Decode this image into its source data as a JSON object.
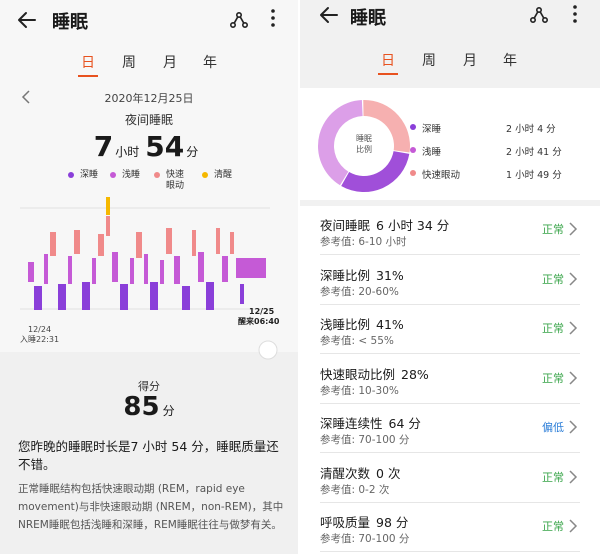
{
  "left": {
    "title": "睡眠",
    "tabs": [
      "日",
      "周",
      "月",
      "年"
    ],
    "active_tab": 0,
    "date": "2020年12月25日",
    "sleep_label": "夜间睡眠",
    "hours": "7",
    "hours_unit": "小时",
    "minutes": "54",
    "minutes_unit": "分",
    "legend": [
      {
        "label": "深睡",
        "color": "#8a3fd9"
      },
      {
        "label": "浅睡",
        "color": "#c55ad6"
      },
      {
        "label": "快速\n眼动",
        "color": "#f08a8a"
      },
      {
        "label": "清醒",
        "color": "#f5b800"
      }
    ],
    "start_date": "12/24",
    "start_time": "入睡22:31",
    "end_date": "12/25",
    "end_time": "醒来06:40",
    "score_label": "得分",
    "score": "85",
    "score_unit": "分",
    "summary": "您昨晚的睡眠时长是7 小时 54 分，睡眠质量还不错。",
    "description": "正常睡眠结构包括快速眼动期 (REM，rapid eye movement)与非快速眼动期 (NREM，non-REM)，其中NREM睡眠包括浅睡和深睡，REM睡眠往往与做梦有关。"
  },
  "right": {
    "title": "睡眠",
    "tabs": [
      "日",
      "周",
      "月",
      "年"
    ],
    "active_tab": 0,
    "donut_center": "睡眠\n比例",
    "breakdown": [
      {
        "label": "深睡",
        "value": "2 小时 4 分",
        "color": "#a04fd9",
        "fraction": 0.31
      },
      {
        "label": "浅睡",
        "value": "2 小时 41 分",
        "color": "#dc9fe8",
        "fraction": 0.41
      },
      {
        "label": "快速眼动",
        "value": "1 小时 49 分",
        "color": "#f6b0b0",
        "fraction": 0.28
      }
    ],
    "metrics": [
      {
        "name": "夜间睡眠",
        "value": "6 小时 34 分",
        "ref": "参考值: 6-10 小时",
        "status": "正常"
      },
      {
        "name": "深睡比例",
        "value": "31%",
        "ref": "参考值: 20-60%",
        "status": "正常"
      },
      {
        "name": "浅睡比例",
        "value": "41%",
        "ref": "参考值: < 55%",
        "status": "正常"
      },
      {
        "name": "快速眼动比例",
        "value": "28%",
        "ref": "参考值: 10-30%",
        "status": "正常"
      },
      {
        "name": "深睡连续性",
        "value": "64 分",
        "ref": "参考值: 70-100 分",
        "status": "偏低"
      },
      {
        "name": "清醒次数",
        "value": "0 次",
        "ref": "参考值: 0-2 次",
        "status": "正常"
      },
      {
        "name": "呼吸质量",
        "value": "98 分",
        "ref": "参考值: 70-100 分",
        "status": "正常"
      }
    ]
  },
  "colors": {
    "accent": "#e8521f",
    "deep": "#8a3fd9",
    "light": "#c55ad6",
    "rem": "#f08a8a",
    "awake": "#f5b800",
    "normal": "#3aa54a",
    "low": "#2e7fd8"
  }
}
